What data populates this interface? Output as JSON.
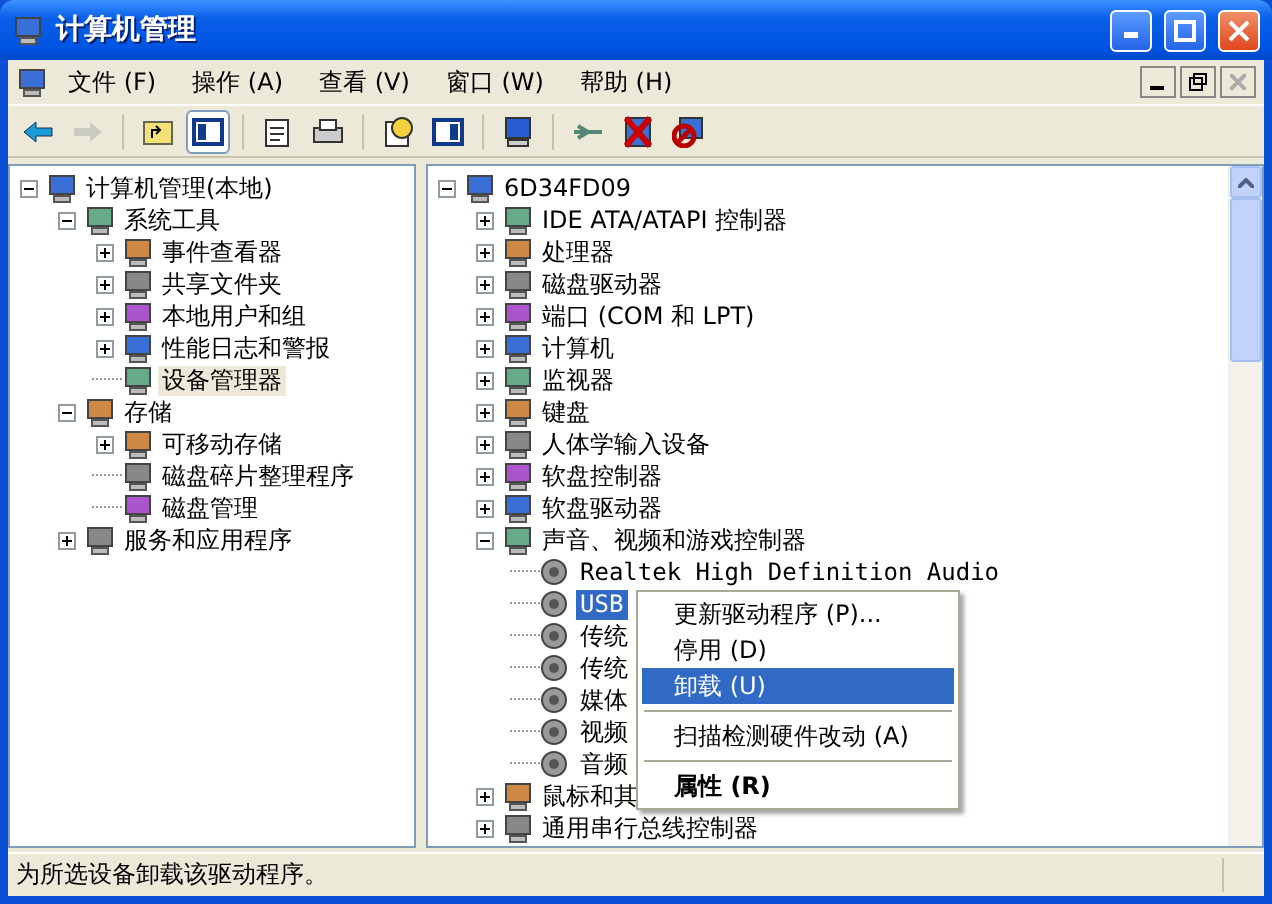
{
  "window": {
    "title": "计算机管理"
  },
  "menu": [
    {
      "label": "文件",
      "key": "(F)"
    },
    {
      "label": "操作",
      "key": "(A)"
    },
    {
      "label": "查看",
      "key": "(V)"
    },
    {
      "label": "窗口",
      "key": "(W)"
    },
    {
      "label": "帮助",
      "key": "(H)"
    }
  ],
  "toolbar": [
    {
      "kind": "back",
      "disabled": false,
      "pressed": false
    },
    {
      "kind": "forward",
      "disabled": true,
      "pressed": false
    },
    {
      "kind": "sep"
    },
    {
      "kind": "up",
      "disabled": false,
      "pressed": false
    },
    {
      "kind": "tree",
      "disabled": false,
      "pressed": true
    },
    {
      "kind": "sep"
    },
    {
      "kind": "properties",
      "disabled": false,
      "pressed": false
    },
    {
      "kind": "print",
      "disabled": false,
      "pressed": false
    },
    {
      "kind": "sep"
    },
    {
      "kind": "help",
      "disabled": false,
      "pressed": false
    },
    {
      "kind": "pane",
      "disabled": false,
      "pressed": false
    },
    {
      "kind": "sep"
    },
    {
      "kind": "scan",
      "disabled": false,
      "pressed": false
    },
    {
      "kind": "sep"
    },
    {
      "kind": "update",
      "disabled": false,
      "pressed": false
    },
    {
      "kind": "uninstall",
      "disabled": false,
      "pressed": false
    },
    {
      "kind": "disable",
      "disabled": false,
      "pressed": false
    }
  ],
  "left_tree": [
    {
      "label": "计算机管理(本地)",
      "selected": false,
      "expanded": true,
      "children": [
        {
          "label": "系统工具",
          "selected": false,
          "expanded": true,
          "children": [
            {
              "label": "事件查看器",
              "selected": false,
              "expanded": false
            },
            {
              "label": "共享文件夹",
              "selected": false,
              "expanded": false
            },
            {
              "label": "本地用户和组",
              "selected": false,
              "expanded": false
            },
            {
              "label": "性能日志和警报",
              "selected": false,
              "expanded": false
            },
            {
              "label": "设备管理器",
              "selected": true
            }
          ]
        },
        {
          "label": "存储",
          "selected": false,
          "expanded": true,
          "children": [
            {
              "label": "可移动存储",
              "selected": false,
              "expanded": false
            },
            {
              "label": "磁盘碎片整理程序",
              "selected": false
            },
            {
              "label": "磁盘管理",
              "selected": false
            }
          ]
        },
        {
          "label": "服务和应用程序",
          "selected": false,
          "expanded": false
        }
      ]
    }
  ],
  "right_tree": [
    {
      "label": "6D34FD09",
      "selected": false,
      "expanded": true,
      "children": [
        {
          "label": "IDE ATA/ATAPI 控制器",
          "selected": false,
          "expanded": false
        },
        {
          "label": "处理器",
          "selected": false,
          "expanded": false
        },
        {
          "label": "磁盘驱动器",
          "selected": false,
          "expanded": false
        },
        {
          "label": "端口 (COM 和 LPT)",
          "selected": false,
          "expanded": false
        },
        {
          "label": "计算机",
          "selected": false,
          "expanded": false
        },
        {
          "label": "监视器",
          "selected": false,
          "expanded": false
        },
        {
          "label": "键盘",
          "selected": false,
          "expanded": false
        },
        {
          "label": "人体学输入设备",
          "selected": false,
          "expanded": false
        },
        {
          "label": "软盘控制器",
          "selected": false,
          "expanded": false
        },
        {
          "label": "软盘驱动器",
          "selected": false,
          "expanded": false
        },
        {
          "label": "声音、视频和游戏控制器",
          "selected": false,
          "expanded": true,
          "children": [
            {
              "label": "Realtek High Definition Audio",
              "selected": false
            },
            {
              "label": "USB",
              "selected": true
            },
            {
              "label": "传统",
              "selected": false
            },
            {
              "label": "传统",
              "selected": false
            },
            {
              "label": "媒体",
              "selected": false
            },
            {
              "label": "视频",
              "selected": false
            },
            {
              "label": "音频",
              "selected": false
            }
          ]
        },
        {
          "label": "鼠标和其",
          "selected": false,
          "expanded": false
        },
        {
          "label": "通用串行总线控制器",
          "selected": false,
          "expanded": false
        }
      ]
    }
  ],
  "context_menu": [
    {
      "kind": "item",
      "label": "更新驱动程序",
      "key": "(P)...",
      "selected": false,
      "bold": false
    },
    {
      "kind": "item",
      "label": "停用",
      "key": "(D)",
      "selected": false,
      "bold": false
    },
    {
      "kind": "item",
      "label": "卸载",
      "key": "(U)",
      "selected": true,
      "bold": false
    },
    {
      "kind": "separator"
    },
    {
      "kind": "item",
      "label": "扫描检测硬件改动",
      "key": "(A)",
      "selected": false,
      "bold": false
    },
    {
      "kind": "separator"
    },
    {
      "kind": "item",
      "label": "属性",
      "key": "(R)",
      "selected": false,
      "bold": true
    }
  ],
  "status_bar": {
    "text": "为所选设备卸载该驱动程序。"
  }
}
